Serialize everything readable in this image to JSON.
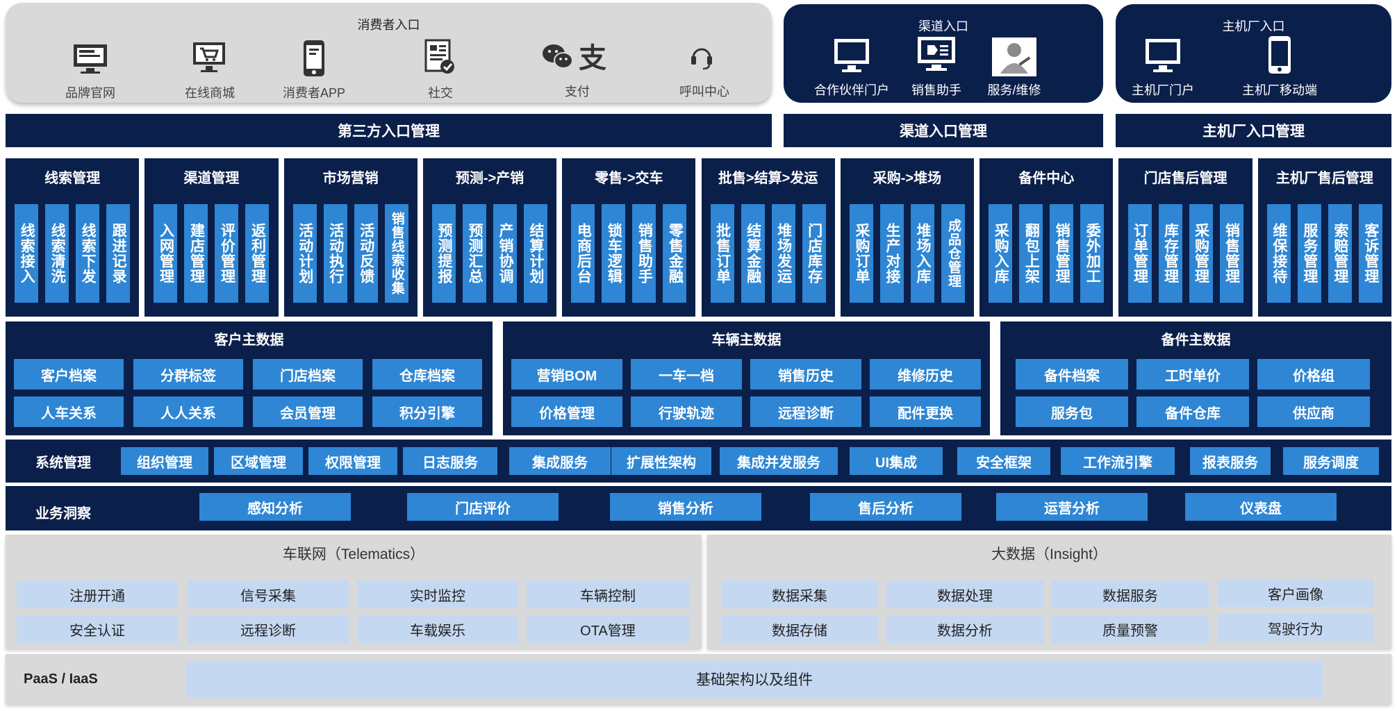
{
  "consumer": {
    "title": "消费者入口",
    "items": [
      "品牌官网",
      "在线商城",
      "消费者APP",
      "社交",
      "支付",
      "呼叫中心"
    ]
  },
  "channel": {
    "title": "渠道入口",
    "items": [
      "合作伙伴门户",
      "销售助手",
      "服务/维修"
    ]
  },
  "oem": {
    "title": "主机厂入口",
    "items": [
      "主机厂门户",
      "主机厂移动端"
    ]
  },
  "mgmt_bars": [
    "第三方入口管理",
    "渠道入口管理",
    "主机厂入口管理"
  ],
  "modules": [
    {
      "title": "线索管理",
      "tiles": [
        "线索接入",
        "线索清洗",
        "线索下发",
        "跟进记录"
      ]
    },
    {
      "title": "渠道管理",
      "tiles": [
        "入网管理",
        "建店管理",
        "评价管理",
        "返利管理"
      ]
    },
    {
      "title": "市场营销",
      "tiles": [
        "活动计划",
        "活动执行",
        "活动反馈",
        "销售线索收集"
      ]
    },
    {
      "title": "预测->产销",
      "tiles": [
        "预测提报",
        "预测汇总",
        "产销协调",
        "结算计划"
      ]
    },
    {
      "title": "零售->交车",
      "tiles": [
        "电商后台",
        "锁车逻辑",
        "销售助手",
        "零售金融"
      ]
    },
    {
      "title": "批售>结算>发运",
      "tiles": [
        "批售订单",
        "结算金融",
        "堆场发运",
        "门店库存"
      ]
    },
    {
      "title": "采购->堆场",
      "tiles": [
        "采购订单",
        "生产对接",
        "堆场入库",
        "成品仓管理"
      ]
    },
    {
      "title": "备件中心",
      "tiles": [
        "采购入库",
        "翻包上架",
        "销售管理",
        "委外加工"
      ]
    },
    {
      "title": "门店售后管理",
      "tiles": [
        "订单管理",
        "库存管理",
        "采购管理",
        "销售管理"
      ]
    },
    {
      "title": "主机厂售后管理",
      "tiles": [
        "维保接待",
        "服务管理",
        "索赔管理",
        "客诉管理"
      ]
    }
  ],
  "customer_master": {
    "title": "客户主数据",
    "row1": [
      "客户档案",
      "分群标签",
      "门店档案",
      "仓库档案"
    ],
    "row2": [
      "人车关系",
      "人人关系",
      "会员管理",
      "积分引擎"
    ]
  },
  "vehicle_master": {
    "title": "车辆主数据",
    "row1": [
      "营销BOM",
      "一车一档",
      "销售历史",
      "维修历史"
    ],
    "row2": [
      "价格管理",
      "行驶轨迹",
      "远程诊断",
      "配件更换"
    ]
  },
  "parts_master": {
    "title": "备件主数据",
    "row1": [
      "备件档案",
      "工时单价",
      "价格组"
    ],
    "row2": [
      "服务包",
      "备件仓库",
      "供应商"
    ]
  },
  "system": {
    "label": "系统管理",
    "items": [
      "组织管理",
      "区域管理",
      "权限管理",
      "日志服务",
      "集成服务",
      "扩展性架构",
      "集成并发服务",
      "UI集成",
      "安全框架",
      "工作流引擎",
      "报表服务",
      "服务调度"
    ]
  },
  "insight": {
    "label": "业务洞察",
    "items": [
      "感知分析",
      "门店评价",
      "销售分析",
      "售后分析",
      "运营分析",
      "仪表盘"
    ]
  },
  "telematics": {
    "title": "车联网（Telematics）",
    "row1": [
      "注册开通",
      "信号采集",
      "实时监控",
      "车辆控制"
    ],
    "row2": [
      "安全认证",
      "远程诊断",
      "车载娱乐",
      "OTA管理"
    ]
  },
  "bigdata": {
    "title": "大数据（Insight）",
    "row1": [
      "数据采集",
      "数据处理",
      "数据服务",
      "客户画像"
    ],
    "row2": [
      "数据存储",
      "数据分析",
      "质量预警",
      "驾驶行为"
    ]
  },
  "paas": {
    "label": "PaaS / IaaS",
    "infra": "基础架构以及组件"
  },
  "icons": {
    "consumer": [
      "monitor-icon",
      "shopping-cart-icon",
      "smartphone-icon",
      "social-doc-icon",
      "wechat-alipay-icon",
      "headset-icon"
    ],
    "channel": [
      "monitor-icon",
      "sales-screen-icon",
      "service-person-icon"
    ],
    "oem": [
      "monitor-icon",
      "smartphone-icon"
    ]
  },
  "colors": {
    "navy": "#0b1f4b",
    "tile_blue": "#2e86d4",
    "light_blue": "#c5d8f1",
    "grey": "#d9d9d9"
  }
}
